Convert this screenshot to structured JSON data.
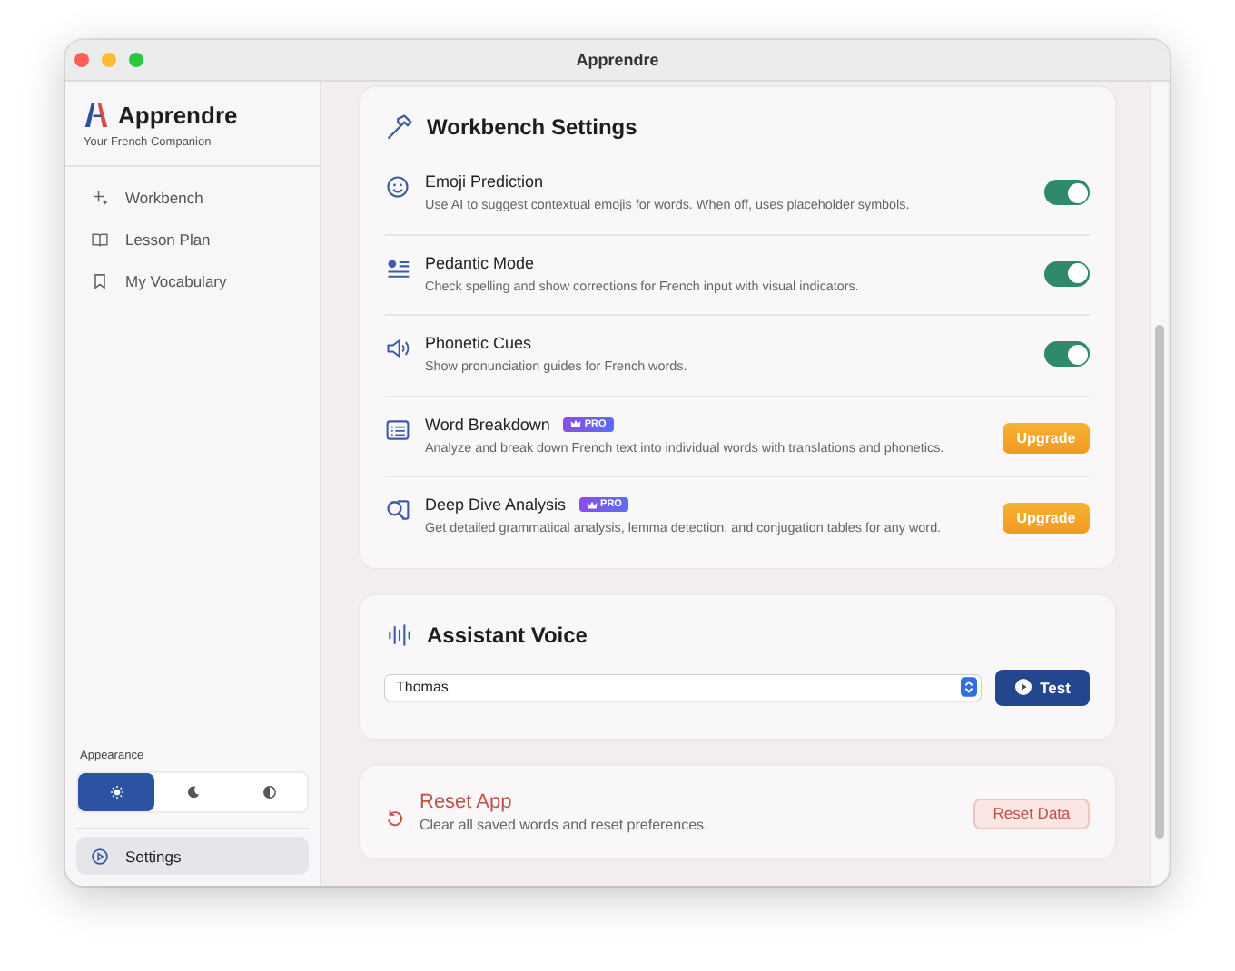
{
  "window": {
    "title": "Apprendre"
  },
  "sidebar": {
    "app_title": "Apprendre",
    "subtitle": "Your French Companion",
    "nav_items": [
      {
        "label": "Workbench",
        "selected": false
      },
      {
        "label": "Lesson Plan",
        "selected": false
      },
      {
        "label": "My Vocabulary",
        "selected": false
      }
    ],
    "appearance": {
      "label": "Appearance",
      "options": [
        {
          "kind": "light",
          "selected": true
        },
        {
          "kind": "dark",
          "selected": false
        },
        {
          "kind": "auto",
          "selected": false
        }
      ]
    },
    "settings_item": {
      "label": "Settings",
      "selected": true
    }
  },
  "workbench": {
    "title": "Workbench Settings",
    "rows": [
      {
        "kind": "toggle",
        "title": "Emoji Prediction",
        "description": "Use AI to suggest contextual emojis for words. When off, uses placeholder symbols.",
        "on": true
      },
      {
        "kind": "toggle",
        "title": "Pedantic Mode",
        "description": "Check spelling and show corrections for French input with visual indicators.",
        "on": true
      },
      {
        "kind": "toggle",
        "title": "Phonetic Cues",
        "description": "Show pronunciation guides for French words.",
        "on": true
      },
      {
        "kind": "upgrade",
        "title": "Word Breakdown",
        "badge": "PRO",
        "description": "Analyze and break down French text into individual words with translations and phonetics.",
        "button": "Upgrade"
      },
      {
        "kind": "upgrade",
        "title": "Deep Dive Analysis",
        "badge": "PRO",
        "description": "Get detailed grammatical analysis, lemma detection, and conjugation tables for any word.",
        "button": "Upgrade"
      }
    ]
  },
  "assistant_voice": {
    "title": "Assistant Voice",
    "voice": "Thomas",
    "button": "Test"
  },
  "reset": {
    "title": "Reset App",
    "description": "Clear all saved words and reset preferences.",
    "button": "Reset Data"
  }
}
